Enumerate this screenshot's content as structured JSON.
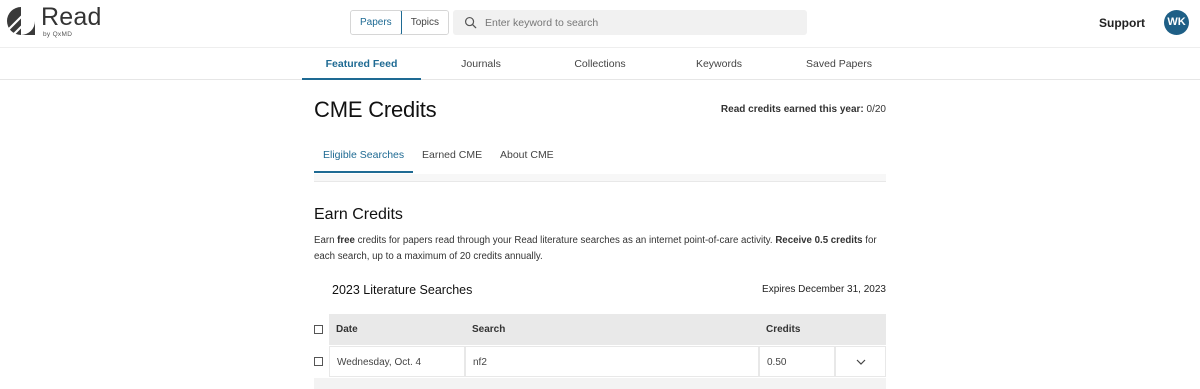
{
  "logo": {
    "word": "Read",
    "sub": "by QxMD"
  },
  "header": {
    "toggle": {
      "papers": "Papers",
      "topics": "Topics"
    },
    "search_placeholder": "Enter keyword to search",
    "support": "Support",
    "avatar_initials": "WK"
  },
  "nav": {
    "items": [
      {
        "label": "Featured Feed",
        "active": true
      },
      {
        "label": "Journals"
      },
      {
        "label": "Collections"
      },
      {
        "label": "Keywords"
      },
      {
        "label": "Saved Papers"
      }
    ]
  },
  "page": {
    "title": "CME Credits",
    "credits_label": "Read credits earned this year:",
    "credits_value": " 0/20"
  },
  "subtabs": [
    {
      "label": "Eligible Searches",
      "active": true
    },
    {
      "label": "Earned CME"
    },
    {
      "label": "About CME"
    }
  ],
  "earn": {
    "title": "Earn Credits",
    "desc_1": "Earn ",
    "desc_free": "free",
    "desc_2": " credits for papers read through your Read literature searches as an internet point-of-care activity. ",
    "desc_bold": "Receive 0.5 credits",
    "desc_3": " for each search, up to a maximum of 20 credits annually."
  },
  "searches": {
    "title": "2023 Literature Searches",
    "expires": "Expires December 31, 2023",
    "columns": [
      "Date",
      "Search",
      "Credits"
    ],
    "rows": [
      {
        "date": "Wednesday, Oct. 4",
        "search": "nf2",
        "credits": "0.50"
      }
    ]
  },
  "colors": {
    "accent": "#1e6a93",
    "avatar": "#1e5f86"
  }
}
